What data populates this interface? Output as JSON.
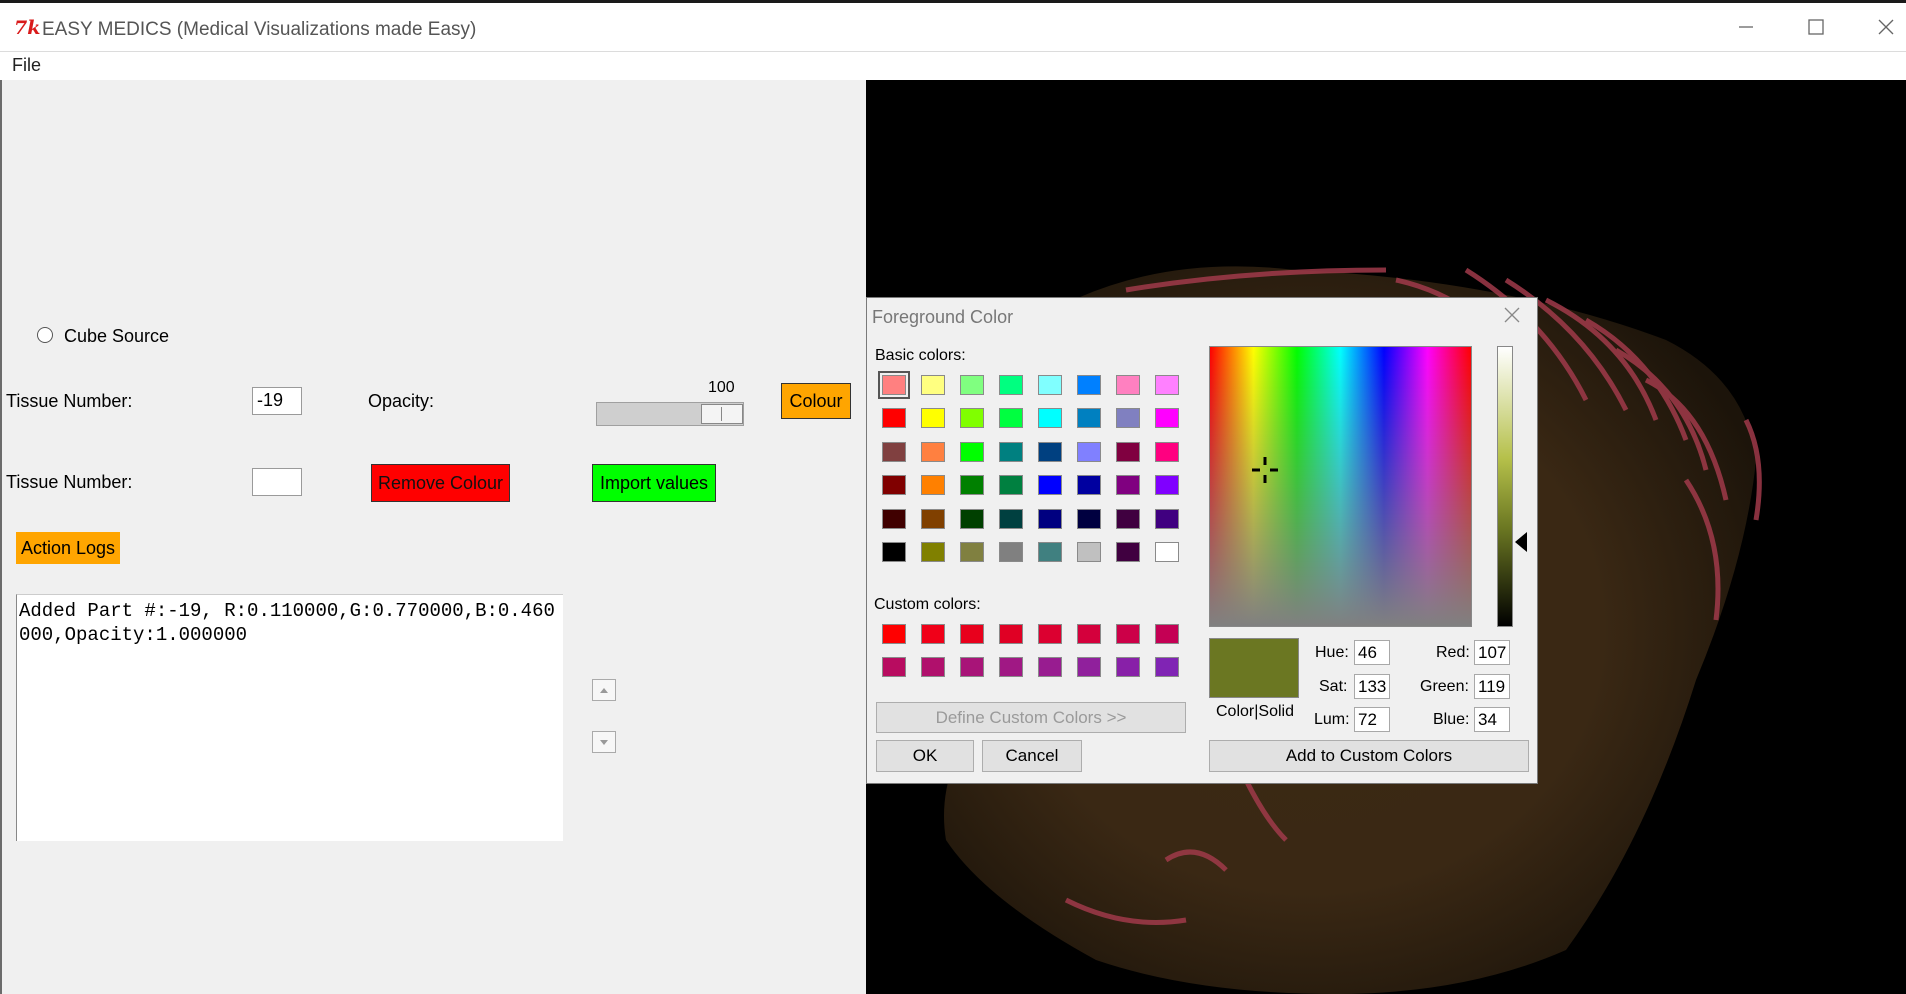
{
  "window": {
    "logo": "7k",
    "title": "EASY MEDICS (Medical Visualizations made Easy)"
  },
  "menu": {
    "file": "File"
  },
  "controls": {
    "cube_source_label": "Cube Source",
    "tissue_label_1": "Tissue Number:",
    "tissue_value_1": "-19",
    "opacity_label": "Opacity:",
    "opacity_value": "100",
    "colour_button": "Colour",
    "tissue_label_2": "Tissue Number:",
    "tissue_value_2": "",
    "remove_colour_button": "Remove Colour",
    "import_values_button": "Import values",
    "action_logs_button": "Action Logs",
    "log_text": "Added Part #:-19, R:0.110000,G:0.770000,B:0.460000,Opacity:1.000000"
  },
  "colors": {
    "orange": "#ffa500",
    "red": "#ff0000",
    "green": "#00ff00",
    "selected_color": "#6b7722"
  },
  "dialog": {
    "title": "Foreground Color",
    "basic_colors_label": "Basic colors:",
    "custom_colors_label": "Custom colors:",
    "define_custom_button": "Define Custom Colors >>",
    "ok_button": "OK",
    "cancel_button": "Cancel",
    "add_custom_button": "Add to Custom Colors",
    "color_solid_label": "Color|Solid",
    "hue_label": "Hue:",
    "hue_value": "46",
    "sat_label": "Sat:",
    "sat_value": "133",
    "lum_label": "Lum:",
    "lum_value": "72",
    "red_label": "Red:",
    "red_value": "107",
    "green_label": "Green:",
    "green_value": "119",
    "blue_label": "Blue:",
    "blue_value": "34",
    "basic_colors": [
      "#ff8080",
      "#ffff80",
      "#80ff80",
      "#00ff80",
      "#80ffff",
      "#0080ff",
      "#ff80c0",
      "#ff80ff",
      "#ff0000",
      "#ffff00",
      "#80ff00",
      "#00ff40",
      "#00ffff",
      "#0080c0",
      "#8080c0",
      "#ff00ff",
      "#804040",
      "#ff8040",
      "#00ff00",
      "#008080",
      "#004080",
      "#8080ff",
      "#800040",
      "#ff0080",
      "#800000",
      "#ff8000",
      "#008000",
      "#008040",
      "#0000ff",
      "#0000a0",
      "#800080",
      "#8000ff",
      "#400000",
      "#804000",
      "#004000",
      "#004040",
      "#000080",
      "#000040",
      "#400040",
      "#400080",
      "#000000",
      "#808000",
      "#808040",
      "#808080",
      "#408080",
      "#c0c0c0",
      "#400040",
      "#ffffff"
    ],
    "custom_colors": [
      "#ff0000",
      "#f00018",
      "#e8001c",
      "#e00024",
      "#dc0030",
      "#d4003c",
      "#cc0048",
      "#c40054",
      "#b80c60",
      "#b0106c",
      "#a81478",
      "#a01884",
      "#981c90",
      "#90209c",
      "#8820a8",
      "#8024b4"
    ]
  }
}
